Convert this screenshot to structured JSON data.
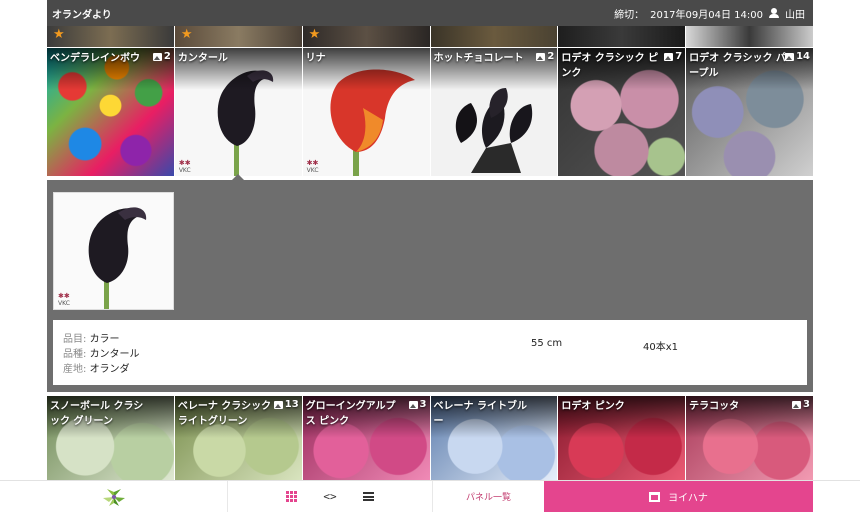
{
  "header": {
    "title": "オランダより",
    "deadline_label": "締切：",
    "deadline_value": "2017年09月04日 14:00",
    "user_name": "山田"
  },
  "colors": {
    "header_bg": "#4a4a4a",
    "accent": "#e4458e",
    "star": "#f29a1f",
    "detail_bg": "#6e6e6e"
  },
  "top_strip": [
    {
      "favorite": true
    },
    {
      "favorite": true
    },
    {
      "favorite": true
    },
    {
      "favorite": false
    },
    {
      "favorite": false
    },
    {
      "favorite": false
    }
  ],
  "row1": [
    {
      "name": "ベンデラレインボウ",
      "count": "2",
      "icon": "rainbow-rose-image"
    },
    {
      "name": "カンタール",
      "count": "",
      "icon": "black-calla-image"
    },
    {
      "name": "リナ",
      "count": "",
      "icon": "red-calla-image"
    },
    {
      "name": "ホットチョコレート",
      "count": "2",
      "icon": "dark-calla-bunch-image"
    },
    {
      "name": "ロデオ クラシック ピンク",
      "count": "7",
      "icon": "pink-hydrangea-image"
    },
    {
      "name": "ロデオ クラシック パープル",
      "count": "14",
      "icon": "purple-hydrangea-image"
    }
  ],
  "detail": {
    "rows": [
      {
        "label": "品目: ",
        "value": "カラー"
      },
      {
        "label": "品種: ",
        "value": "カンタール"
      },
      {
        "label": "産地: ",
        "value": "オランダ"
      }
    ],
    "length": "55 cm",
    "quantity": "40本x1"
  },
  "row2": [
    {
      "name": "スノーボール クラシック グリーン",
      "count": "",
      "icon": "green-hydrangea-image"
    },
    {
      "name": "ベレーナ クラシック ライトグリーン",
      "count": "13",
      "icon": "light-green-hydrangea-image"
    },
    {
      "name": "グローイングアルプス ピンク",
      "count": "3",
      "icon": "pink-hydrangea-image"
    },
    {
      "name": "ベレーナ ライトブルー",
      "count": "",
      "icon": "light-blue-hydrangea-image"
    },
    {
      "name": "ロデオ ピンク",
      "count": "",
      "icon": "red-hydrangea-image"
    },
    {
      "name": "テラコッタ",
      "count": "3",
      "icon": "terracotta-hydrangea-image"
    }
  ],
  "bottom_bar": {
    "panel_list_label": "パネル一覧",
    "shop_label": "ヨイハナ"
  },
  "watermark": "VKC"
}
